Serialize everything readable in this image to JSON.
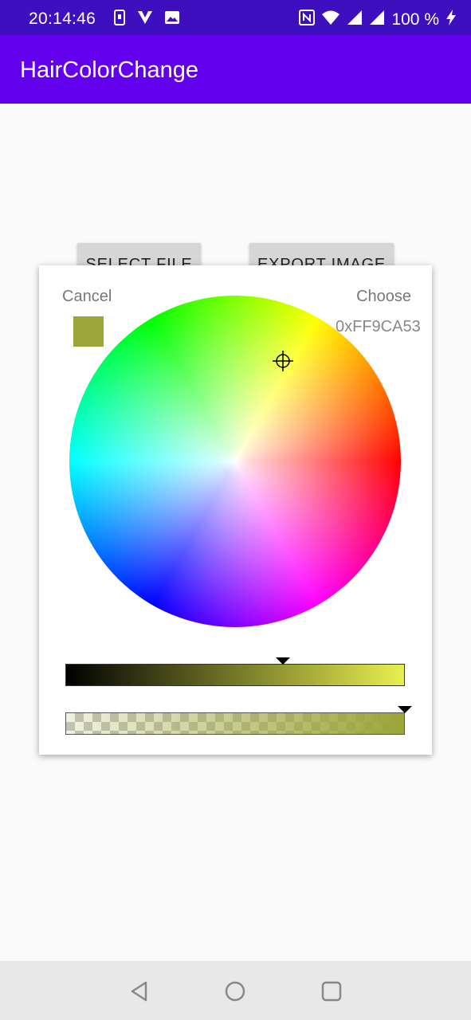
{
  "status_bar": {
    "time": "20:14:46",
    "battery": "100 %",
    "left_icons": [
      "notification-icon",
      "vpn-app-icon",
      "gallery-icon"
    ],
    "right_icons": [
      "nfc-icon",
      "wifi-icon",
      "signal-icon",
      "signal-icon",
      "charging-icon"
    ]
  },
  "app_bar": {
    "title": "HairColorChange"
  },
  "buttons": {
    "select_file": "SELECT FILE",
    "export_image": "EXPORT IMAGE"
  },
  "dialog": {
    "cancel": "Cancel",
    "choose": "Choose",
    "hex": "0xFF9CA53",
    "selected_color": "#9ca538",
    "value_slider_level": 0.64,
    "alpha_slider_level": 1.0,
    "colors": {
      "value_end": "#e8f050",
      "value_start": "#000000"
    }
  },
  "colors": {
    "status_bar": "#3e0fbf",
    "app_bar": "#6200ee"
  },
  "nav": {
    "icons": [
      "back-icon",
      "home-icon",
      "recents-icon"
    ]
  }
}
